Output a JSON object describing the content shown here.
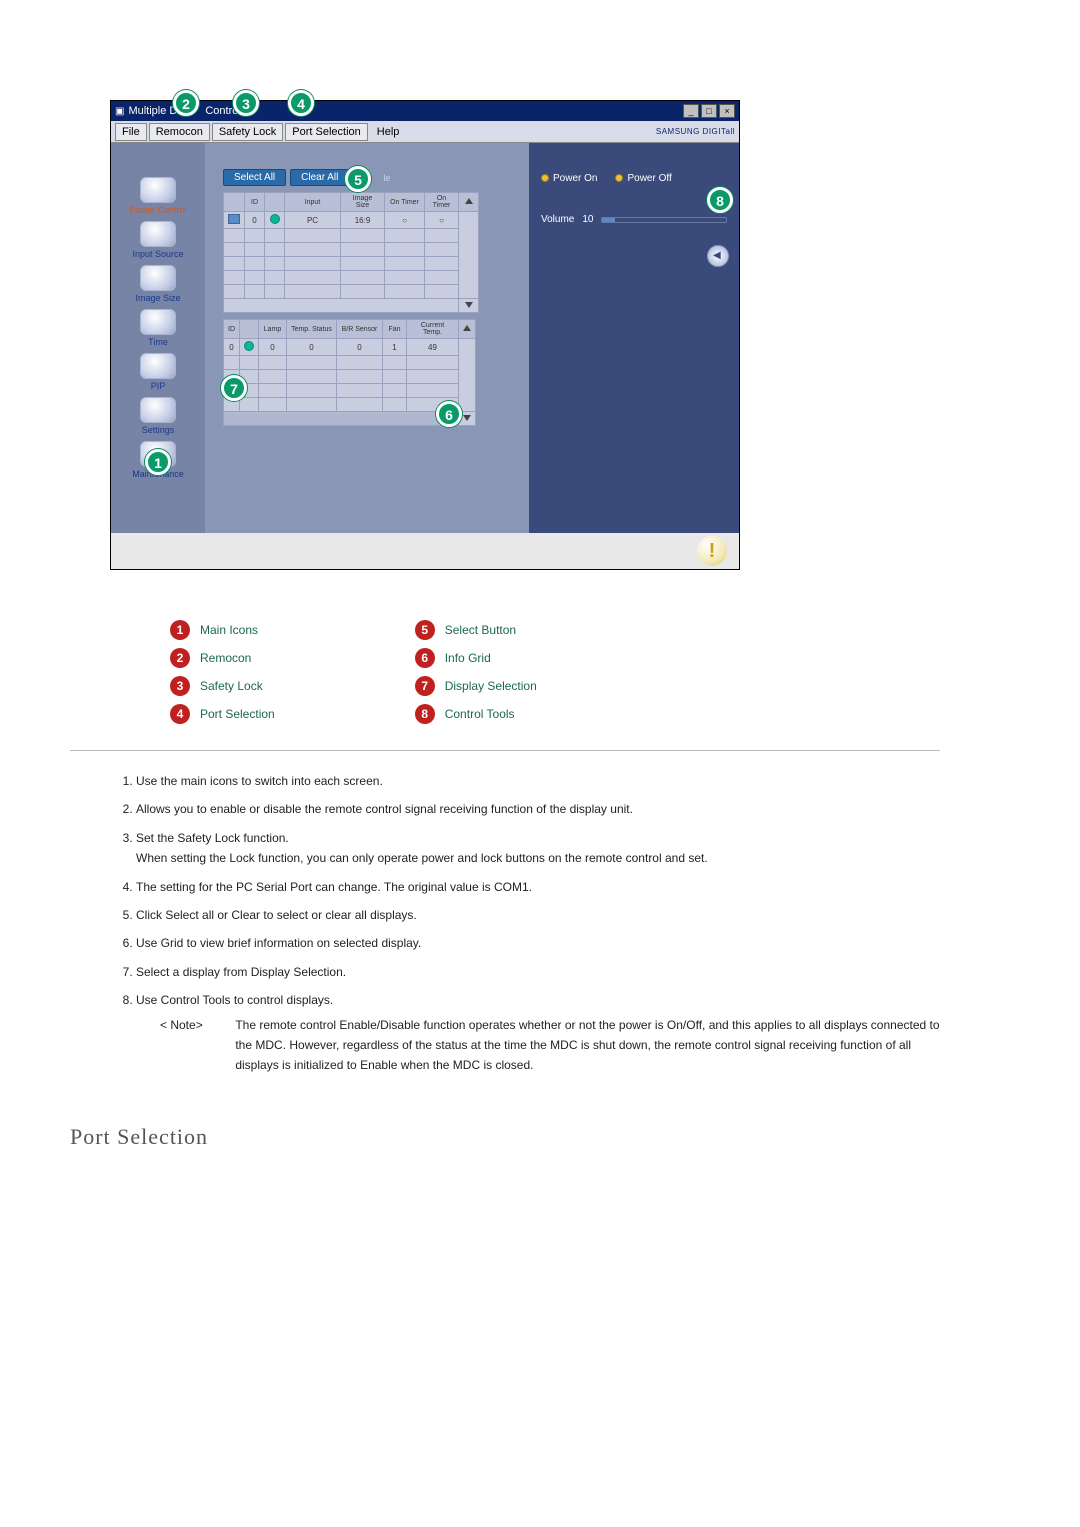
{
  "window": {
    "title_prefix": "Multiple D",
    "title_mid": "Control",
    "win_min": "_",
    "win_max": "□",
    "win_close": "×"
  },
  "menu": {
    "file": "File",
    "remocon": "Remocon",
    "safety_lock": "Safety Lock",
    "port_selection": "Port Selection",
    "help": "Help",
    "brand": "SAMSUNG DIGITall"
  },
  "sidebar": {
    "power_control": "Power Control",
    "input_source": "Input Source",
    "image_size": "Image Size",
    "time": "Time",
    "pip": "PIP",
    "settings": "Settings",
    "maintenance": "Maintenance"
  },
  "center": {
    "select_all": "Select All",
    "clear_all": "Clear All",
    "suffix_le": "le",
    "grid1": {
      "headers": [
        "",
        "ID",
        "",
        "Input",
        "Image Size",
        "On Timer",
        "On Timer"
      ],
      "row_id": "0",
      "row_input": "PC",
      "row_size": "16:9",
      "row_on": "○",
      "row_on2": "○"
    },
    "grid2": {
      "headers": [
        "ID",
        "",
        "Lamp",
        "Temp. Status",
        "B/R Sensor",
        "Fan",
        "Current Temp."
      ],
      "row": [
        "0",
        "",
        "0",
        "0",
        "0",
        "1",
        "49"
      ]
    }
  },
  "right": {
    "power_on": "Power On",
    "power_off": "Power Off",
    "volume_label": "Volume",
    "volume_value": "10"
  },
  "bubbles": {
    "b1": "1",
    "b2": "2",
    "b3": "3",
    "b4": "4",
    "b5": "5",
    "b6": "6",
    "b7": "7",
    "b8": "8"
  },
  "legend": {
    "l1": "Main Icons",
    "l2": "Remocon",
    "l3": "Safety Lock",
    "l4": "Port Selection",
    "l5": "Select Button",
    "l6": "Info Grid",
    "l7": "Display Selection",
    "l8": "Control Tools"
  },
  "desc": {
    "d1": "Use the main icons to switch into each screen.",
    "d2": "Allows you to enable or disable the remote control signal receiving function of the display unit.",
    "d3a": "Set the Safety Lock function.",
    "d3b": "When setting the Lock function, you can only operate power and lock buttons on the remote control and set.",
    "d4": "The setting for the PC Serial Port can change. The original value is COM1.",
    "d5": "Click Select all or Clear to select or clear all displays.",
    "d6": "Use Grid to view brief information on selected display.",
    "d7": "Select a display from Display Selection.",
    "d8": "Use Control Tools to control displays.",
    "note_label": "< Note>",
    "note_text": "The remote control Enable/Disable function operates whether or not the power is On/Off, and this applies to all displays connected to the MDC. However, regardless of the status at the time the MDC is shut down, the remote control signal receiving function of all displays is initialized to Enable when the MDC is closed."
  },
  "section_heading": "Port Selection"
}
